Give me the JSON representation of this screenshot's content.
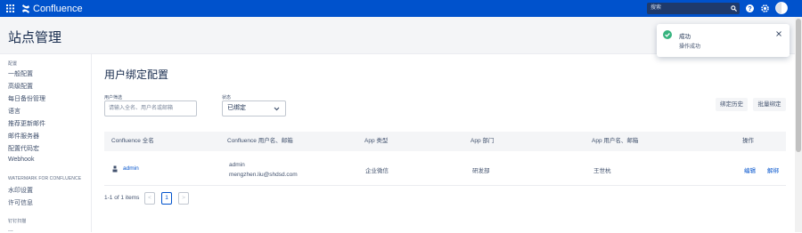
{
  "topbar": {
    "brand": "Confluence",
    "search_placeholder": "搜索",
    "apps_icon": "grid-icon",
    "help_icon": "help-icon",
    "settings_icon": "gear-icon",
    "avatar": "user-avatar"
  },
  "page": {
    "title": "站点管理"
  },
  "sidebar": {
    "group1": "配置",
    "items1": [
      "一般配置",
      "高级配置",
      "每日备份管理",
      "语言",
      "推荐更新邮件",
      "邮件服务器",
      "配置代码宏",
      "Webhook"
    ],
    "group2": "WATERMARK FOR CONFLUENCE",
    "items2": [
      "水印设置",
      "许可信息"
    ],
    "group3": "钉钉扫描",
    "items3": [
      "..."
    ]
  },
  "main": {
    "title": "用户绑定配置",
    "filter_label": "用户筛选",
    "filter_placeholder": "请输入全名、用户名或邮箱",
    "status_label": "状态",
    "status_value": "已绑定",
    "history_button": "绑定历史",
    "batch_button": "批量绑定"
  },
  "table": {
    "headers": [
      "Confluence 全名",
      "Confluence 用户名、邮箱",
      "App 类型",
      "App 部门",
      "App 用户名、邮箱",
      "操作"
    ],
    "rows": [
      {
        "fullname": "admin",
        "username": "admin",
        "email": "mengzhen.liu@shdsd.com",
        "app_type": "企业微信",
        "dept": "研发部",
        "app_user": "王世杭",
        "edit": "编辑",
        "unbind": "解绑"
      }
    ]
  },
  "pagination": {
    "summary": "1-1 of 1 items",
    "current": "1",
    "prev": "<",
    "next": ">"
  },
  "toast": {
    "title": "成功",
    "message": "操作成功",
    "close": "×"
  },
  "colors": {
    "brand": "#0052cc",
    "success": "#36b37e"
  }
}
